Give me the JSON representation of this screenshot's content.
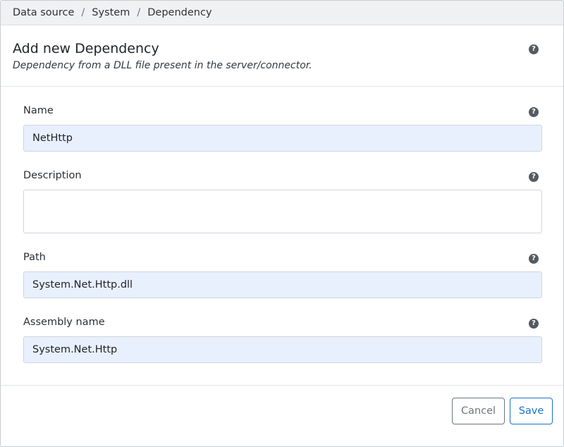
{
  "breadcrumb": {
    "items": [
      "Data source",
      "System",
      "Dependency"
    ],
    "separator": "/"
  },
  "header": {
    "title": "Add new Dependency",
    "subtitle": "Dependency from a DLL file present in the server/connector.",
    "help_icon": "?"
  },
  "form": {
    "name": {
      "label": "Name",
      "value": "NetHttp"
    },
    "description": {
      "label": "Description",
      "value": ""
    },
    "path": {
      "label": "Path",
      "value": "System.Net.Http.dll"
    },
    "assembly_name": {
      "label": "Assembly name",
      "value": "System.Net.Http"
    },
    "help_icon": "?"
  },
  "footer": {
    "cancel_label": "Cancel",
    "save_label": "Save"
  },
  "colors": {
    "accent": "#1a73c9",
    "input_fill": "#e8f0fe",
    "breadcrumb_bg": "#f0f1f3"
  }
}
